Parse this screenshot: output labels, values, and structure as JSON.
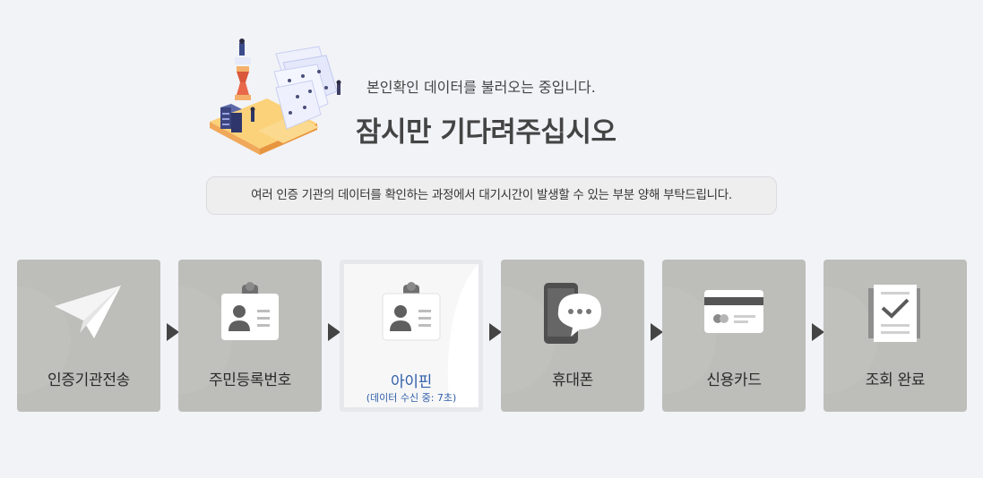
{
  "header": {
    "subtitle": "본인확인 데이터를 불러오는 중입니다.",
    "title": "잠시만 기다려주십시오"
  },
  "notice": "여러 인증 기관의 데이터를 확인하는 과정에서 대기시간이 발생할 수 있는 부분 양해 부탁드립니다.",
  "steps": [
    {
      "label": "인증기관전송",
      "icon": "paper-plane-icon"
    },
    {
      "label": "주민등록번호",
      "icon": "id-card-icon"
    },
    {
      "label": "아이핀",
      "sublabel": "(데이터 수신 중: 7초)",
      "icon": "id-card-icon",
      "active": true
    },
    {
      "label": "휴대폰",
      "icon": "mobile-phone-icon"
    },
    {
      "label": "신용카드",
      "icon": "credit-card-icon"
    },
    {
      "label": "조회 완료",
      "icon": "document-check-icon"
    }
  ],
  "colors": {
    "background": "#f2f3f7",
    "step_inactive": "#bdbdba",
    "step_active": "#f7f7f8",
    "active_text": "#2f5fa8",
    "arrow": "#444444"
  }
}
